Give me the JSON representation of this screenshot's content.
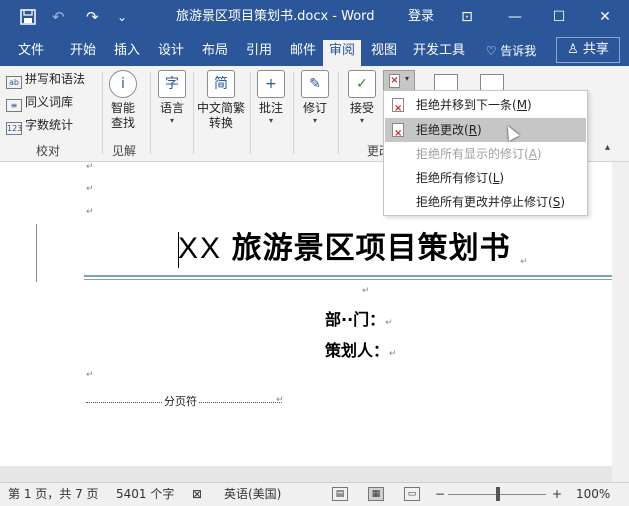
{
  "titlebar": {
    "title": "旅游景区项目策划书.docx - Word",
    "login": "登录",
    "save_icon": "save-icon",
    "undo_glyph": "↶",
    "redo_glyph": "↷",
    "customize_glyph": "⌄",
    "ribbon_display_glyph": "⊡",
    "minimize_glyph": "—",
    "restore_glyph": "☐",
    "close_glyph": "✕"
  },
  "tabs": [
    {
      "label": "文件"
    },
    {
      "label": "开始"
    },
    {
      "label": "插入"
    },
    {
      "label": "设计"
    },
    {
      "label": "布局"
    },
    {
      "label": "引用"
    },
    {
      "label": "邮件"
    },
    {
      "label": "审阅"
    },
    {
      "label": "视图"
    },
    {
      "label": "开发工具"
    },
    {
      "label": "告诉我"
    }
  ],
  "share_label": "共享",
  "ribbon": {
    "proofing": {
      "spelling": "拼写和语法",
      "thesaurus": "同义词库",
      "wordcount": "字数统计",
      "group": "校对"
    },
    "insights": {
      "smart_lookup": "智能查找",
      "group": "见解"
    },
    "language": "语言",
    "chinese_convert": "中文简繁转换",
    "comments": "批注",
    "tracking": "修订",
    "accept": "接受",
    "changes_group": "更改"
  },
  "menu": {
    "items": [
      {
        "label": "拒绝并移到下一条(",
        "key": "M",
        "tail": ")"
      },
      {
        "label": "拒绝更改(",
        "key": "R",
        "tail": ")"
      },
      {
        "label": "拒绝所有显示的修订(",
        "key": "A",
        "tail": ")"
      },
      {
        "label": "拒绝所有修订(",
        "key": "L",
        "tail": ")"
      },
      {
        "label": "拒绝所有更改并停止修订(",
        "key": "S",
        "tail": ")"
      }
    ]
  },
  "document": {
    "title_xx": "XX",
    "title_cn": "旅游景区项目策划书",
    "dept_label": "部··门：",
    "planner_label": "策划人：",
    "page_break": "分页符",
    "para_mark": "↵"
  },
  "status": {
    "page": "第 1 页，共 7 页",
    "words": "5401 个字",
    "language": "英语(美国)",
    "zoom": "100%",
    "zoom_minus": "−",
    "zoom_plus": "+"
  },
  "colors": {
    "brand": "#2b579a",
    "menu_highlight": "#c6c6c6"
  }
}
